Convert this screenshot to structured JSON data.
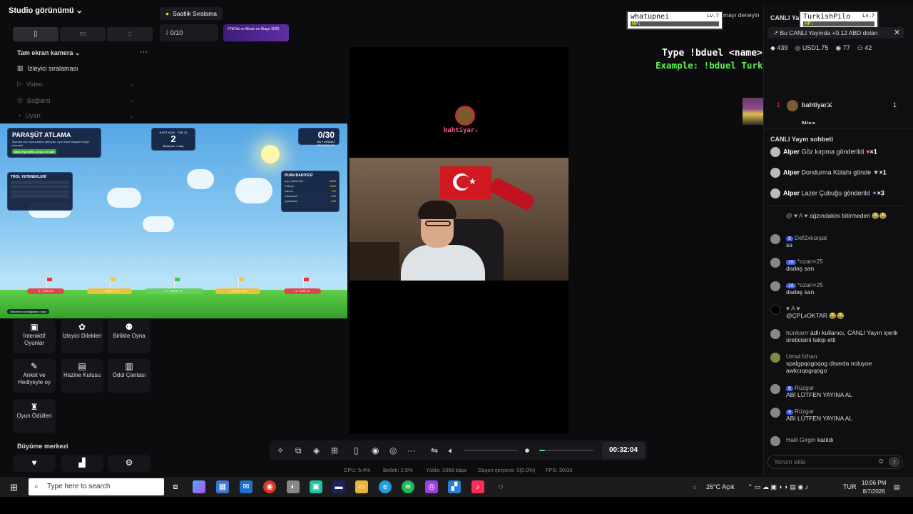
{
  "studio": {
    "title": "Studio görünümü",
    "tabs": [
      "▯",
      "▭",
      "⌂"
    ],
    "fullscreen_label": "Tam ekran kamera",
    "more": "···",
    "viewer_ranking": "İzleyici sıralaması",
    "sections": [
      "Video",
      "Bağlantı",
      "Uyarı"
    ],
    "grid": [
      {
        "icon": "▣",
        "label": "İnteraktif Oyunlar"
      },
      {
        "icon": "✿",
        "label": "İzleyici Dilekleri"
      },
      {
        "icon": "⚉",
        "label": "Birlikte Oyna"
      },
      {
        "icon": "✎",
        "label": "Anket ve Hediyeyle oy"
      },
      {
        "icon": "▤",
        "label": "Hazine Kutusu"
      },
      {
        "icon": "▥",
        "label": "Ödül Çantası"
      },
      {
        "icon": "♜",
        "label": "Oyun Ödülleri"
      }
    ],
    "growth_label": "Büyüme merkezi"
  },
  "top": {
    "hourly_label": "Saatlik Sıralama",
    "goal_value": "0/10",
    "promo_text": "#TikTok on Music on Stage 2026"
  },
  "game": {
    "title": "PARAŞÜT ATLAMA",
    "subtitle": "Numara seç veya sadece latla yaz; oyun sana rastgele bölge verecek!",
    "cta": "latla veya latla 1-5 yaz ve katıl",
    "timer_label": "KAYIT AÇIK · TUR 10",
    "timer_value": "2",
    "timer_sub": "Bekleyen: 5 atla",
    "count": "0/30",
    "count_sub": "BU TURDAKİ ATLAYANLAR",
    "trol_title": "TROL YETENEKLERİ",
    "puan_title": "PUAN BAKİYESİ",
    "puan_rows": [
      {
        "name": "ayo_sikaru1b4",
        "pts": "5850"
      },
      {
        "name": "Pokeyo",
        "pts": "1945"
      },
      {
        "name": "yalova",
        "pts": "732"
      },
      {
        "name": "whatupnei",
        "pts": "554"
      },
      {
        "name": "yywwerlke",
        "pts": "253"
      }
    ],
    "zones": [
      "1 · ZOR x3",
      "2 · ORTA x1.5",
      "3 · KOLAY x1",
      "4 · ORTA x1.5",
      "5 · ZOR x3"
    ],
    "footer": "Streamer.bot bağlantısı hazır"
  },
  "overlay": {
    "player1": {
      "name": "whatupnei",
      "level": "Lv.7",
      "hp": "HP:"
    },
    "player2": {
      "name": "TurkishPilo",
      "level": "Lv.7",
      "hp": "HP:"
    },
    "line1": "Type !bduel <name> to play",
    "line2": "Example: !bduel TurkishPilot",
    "live_name": "bahtiyar⚔",
    "invite_text": "mayı deneyin"
  },
  "right": {
    "header": "CANLI Yay",
    "notice": "Bu CANLI Yayında +0.12 ABD doları",
    "stats": [
      "439",
      "USD1.75",
      "77",
      "42"
    ],
    "top_viewer": {
      "rank": "1",
      "name": "bahtiyar⚔",
      "count": "1"
    },
    "cut_name": "Nisa",
    "chat_title": "CANLI Yayın sohbeti",
    "gifts": [
      {
        "user": "Alper",
        "text": "Göz kırpma gönderildi",
        "count": "×1"
      },
      {
        "user": "Alper",
        "text": "Dondurma Külahı gönde",
        "count": "×1"
      },
      {
        "user": "Alper",
        "text": "Lazer Çubuğu gönderild",
        "count": "×3"
      }
    ],
    "chat": [
      {
        "user": "@ ♥ A ♥",
        "level": "",
        "msg": "ağzındakini bitirmeden 😂😂"
      },
      {
        "user": "Def2xkürşat",
        "level": "9",
        "msg": "sa"
      },
      {
        "user": "*ozan×25",
        "level": "16",
        "msg": "dadaş san"
      },
      {
        "user": "*ozan×25",
        "level": "16",
        "msg": "dadaş san"
      },
      {
        "user": "♥ A ♥",
        "level": "",
        "msg": "@ÇPLxOKTAR 😂😂"
      },
      {
        "user": "hünkarrr",
        "level": "",
        "msg": "adlı kullanıcı, CANLI Yayın içerik üreticisini takip etti"
      },
      {
        "user": "Umut İzhan",
        "level": "",
        "msg": "spalgpqogoqog disarda noluyoe awkcıqogıqogo"
      },
      {
        "user": "Rüzgar",
        "level": "9",
        "msg": "ABİ LÜTFEN YAYINA AL"
      },
      {
        "user": "Rüzgar",
        "level": "9",
        "msg": "ABİ LÜTFEN YAYINA AL"
      },
      {
        "user": "Halil Girgin",
        "level": "",
        "msg": "katıldı"
      }
    ],
    "comment_placeholder": "Yorum ekle"
  },
  "controls": {
    "timer": "00:32:04",
    "mic_level": 0.1
  },
  "status": {
    "cpu": "CPU: 5.4%",
    "memory": "Bellek: 2.5%",
    "upload": "Yükle: 3368 kbps",
    "dropped": "Düşen çerçeve: 0(0.0%)",
    "fps": "FPS: 30/30"
  },
  "taskbar": {
    "search_placeholder": "Type here to search",
    "weather": "26°C Açık",
    "lang": "TUR",
    "time": "10:06 PM",
    "date": "8/7/2026"
  },
  "colors": {
    "accent": "#fe2c55",
    "sky": "#8ccbf2",
    "grass": "#4ec33d"
  }
}
